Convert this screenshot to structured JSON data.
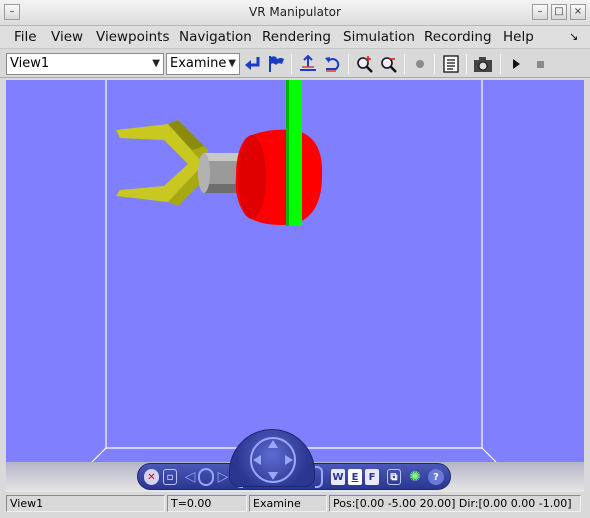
{
  "window": {
    "title": "VR Manipulator"
  },
  "menu": {
    "items": [
      {
        "label": "File"
      },
      {
        "label": "View"
      },
      {
        "label": "Viewpoints"
      },
      {
        "label": "Navigation"
      },
      {
        "label": "Rendering"
      },
      {
        "label": "Simulation"
      },
      {
        "label": "Recording"
      },
      {
        "label": "Help"
      }
    ]
  },
  "toolbar": {
    "viewpoint_value": "View1",
    "navmode_value": "Examine"
  },
  "navpanel": {
    "walk_label": "W",
    "examine_label": "E",
    "fly_label": "F"
  },
  "status": {
    "viewpoint": "View1",
    "time": "T=0.00",
    "mode": "Examine",
    "posdir": "Pos:[0.00 -5.00 20.00]  Dir:[0.00 0.00 -1.00]"
  },
  "colors": {
    "background": "#8080ff",
    "floor_lines": "#ffffff",
    "gripper": "#c8c820",
    "arm_cylinder": "#9a9a9a",
    "joint": "#ff0000",
    "pole": "#00ff00",
    "nav_panel": "#2a3690",
    "toolbar_icons": "#1a3cc8"
  }
}
